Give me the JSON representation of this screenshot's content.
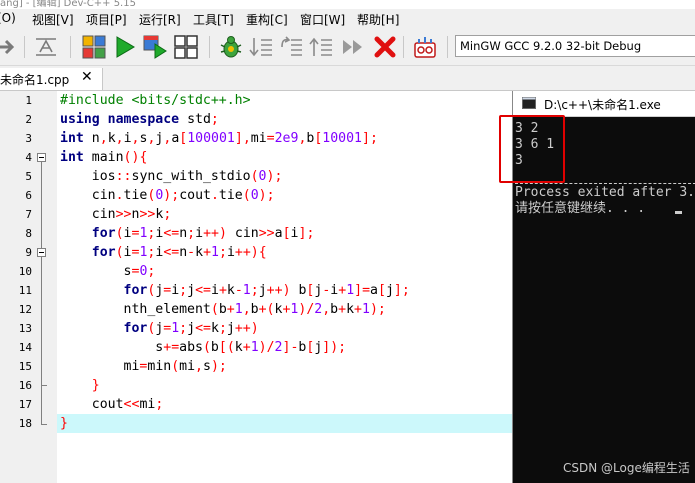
{
  "window": {
    "title_fragment": "ang] - [编辑] Dev-C++ 5.15"
  },
  "menu": [
    "(O)",
    "视图[V]",
    "项目[P]",
    "运行[R]",
    "工具[T]",
    "重构[C]",
    "窗口[W]",
    "帮助[H]"
  ],
  "toolbar": {
    "compiler": "MinGW GCC 9.2.0 32-bit Debug",
    "icons": [
      "indent-icon",
      "comment-icon",
      "compile-icon",
      "run-icon",
      "compile-run-icon",
      "rebuild-icon",
      "debug-icon",
      "step-icon",
      "step-over-icon",
      "step-out-icon",
      "continue-icon",
      "stop-icon",
      "profile-icon"
    ]
  },
  "tabs": [
    {
      "label": "未命名1.cpp",
      "close": "✕"
    }
  ],
  "editor": {
    "line_numbers": [
      "1",
      "2",
      "3",
      "4",
      "5",
      "6",
      "7",
      "8",
      "9",
      "10",
      "11",
      "12",
      "13",
      "14",
      "15",
      "16",
      "17",
      "18"
    ],
    "current_line": 18,
    "lines": [
      "#include <bits/stdc++.h>",
      "using namespace std;",
      "int n,k,i,s,j,a[100001],mi=2e9,b[10001];",
      "int main(){",
      "    ios::sync_with_stdio(0);",
      "    cin.tie(0);cout.tie(0);",
      "    cin>>n>>k;",
      "    for(i=1;i<=n;i++) cin>>a[i];",
      "    for(i=1;i<=n-k+1;i++){",
      "        s=0;",
      "        for(j=i;j<=i+k-1;j++) b[j-i+1]=a[j];",
      "        nth_element(b+1,b+(k+1)/2,b+k+1);",
      "        for(j=1;j<=k;j++)",
      "            s+=abs(b[(k+1)/2]-b[j]);",
      "        mi=min(mi,s);",
      "    }",
      "    cout<<mi;",
      "}"
    ]
  },
  "console": {
    "title": "D:\\c++\\未命名1.exe",
    "output": [
      "3 2",
      "3 6 1",
      "3"
    ],
    "exit_message": "Process exited after 3.",
    "prompt": "请按任意键继续. . ."
  },
  "watermark": "CSDN @Loge编程生活",
  "colors": {
    "keyword": "#000080",
    "preprocessor": "#008000",
    "number": "#8000ff",
    "symbol": "#ff0000",
    "current_line": "#ccf8fb",
    "highlight_box": "#e00000"
  }
}
